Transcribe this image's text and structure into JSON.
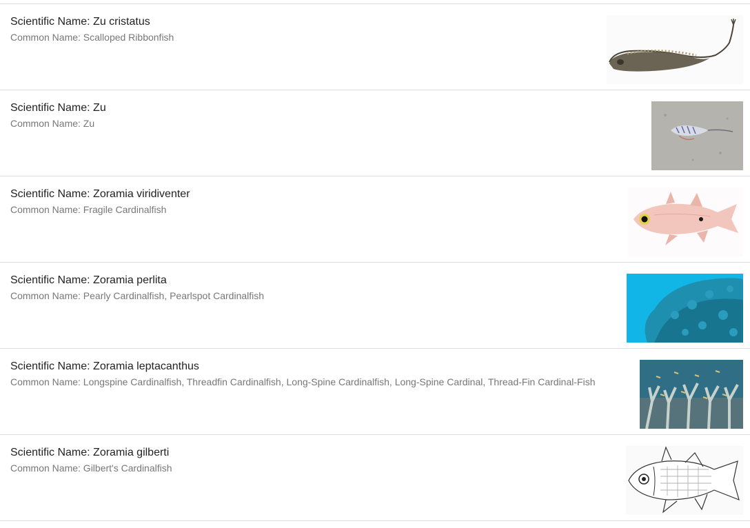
{
  "species": [
    {
      "scientific_label": "Scientific Name: Zu cristatus",
      "common_label": "Common Name: Scalloped Ribbonfish",
      "image": "ribbonfish-photo"
    },
    {
      "scientific_label": "Scientific Name: Zu",
      "common_label": "Common Name: Zu",
      "image": "fish-on-sand-photo"
    },
    {
      "scientific_label": "Scientific Name: Zoramia viridiventer",
      "common_label": "Common Name: Fragile Cardinalfish",
      "image": "pink-cardinalfish-photo"
    },
    {
      "scientific_label": "Scientific Name: Zoramia perlita",
      "common_label": "Common Name: Pearly Cardinalfish, Pearlspot Cardinalfish",
      "image": "blue-coral-reef-photo"
    },
    {
      "scientific_label": "Scientific Name: Zoramia leptacanthus",
      "common_label": "Common Name: Longspine Cardinalfish, Threadfin Cardinalfish, Long-Spine Cardinalfish, Long-Spine Cardinal, Thread-Fin Cardinal-Fish",
      "image": "coral-school-photo"
    },
    {
      "scientific_label": "Scientific Name: Zoramia gilberti",
      "common_label": "Common Name: Gilbert's Cardinalfish",
      "image": "fish-line-drawing"
    }
  ]
}
